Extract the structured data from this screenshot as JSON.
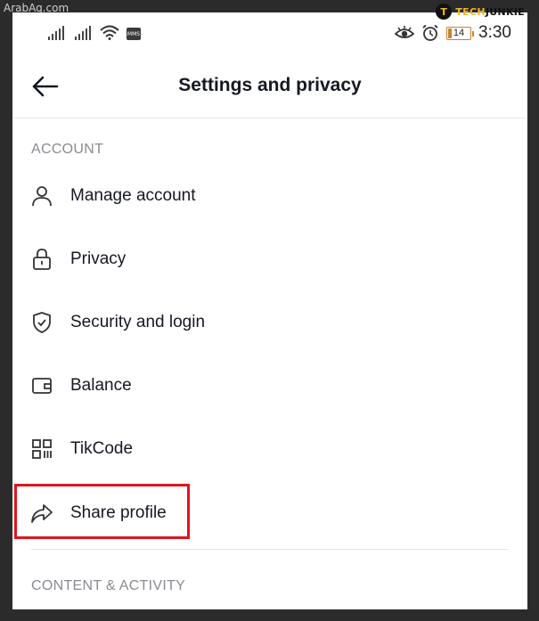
{
  "watermark": "ArabAq.com",
  "brand": {
    "logo_letter": "T",
    "part1": "TECH",
    "part2": "JUNKIE"
  },
  "status": {
    "mms": "MMS",
    "battery": "14",
    "time": "3:30"
  },
  "header": {
    "title": "Settings and privacy"
  },
  "sections": {
    "account": "ACCOUNT",
    "content": "CONTENT & ACTIVITY"
  },
  "items": [
    {
      "label": "Manage account",
      "icon": "person-icon"
    },
    {
      "label": "Privacy",
      "icon": "lock-icon"
    },
    {
      "label": "Security and login",
      "icon": "shield-icon"
    },
    {
      "label": "Balance",
      "icon": "wallet-icon"
    },
    {
      "label": "TikCode",
      "icon": "qr-code-icon"
    },
    {
      "label": "Share profile",
      "icon": "share-icon"
    }
  ],
  "colors": {
    "highlight": "#e0141e",
    "brand_accent": "#f0b429",
    "text": "#161823",
    "section": "#8a8b91"
  }
}
